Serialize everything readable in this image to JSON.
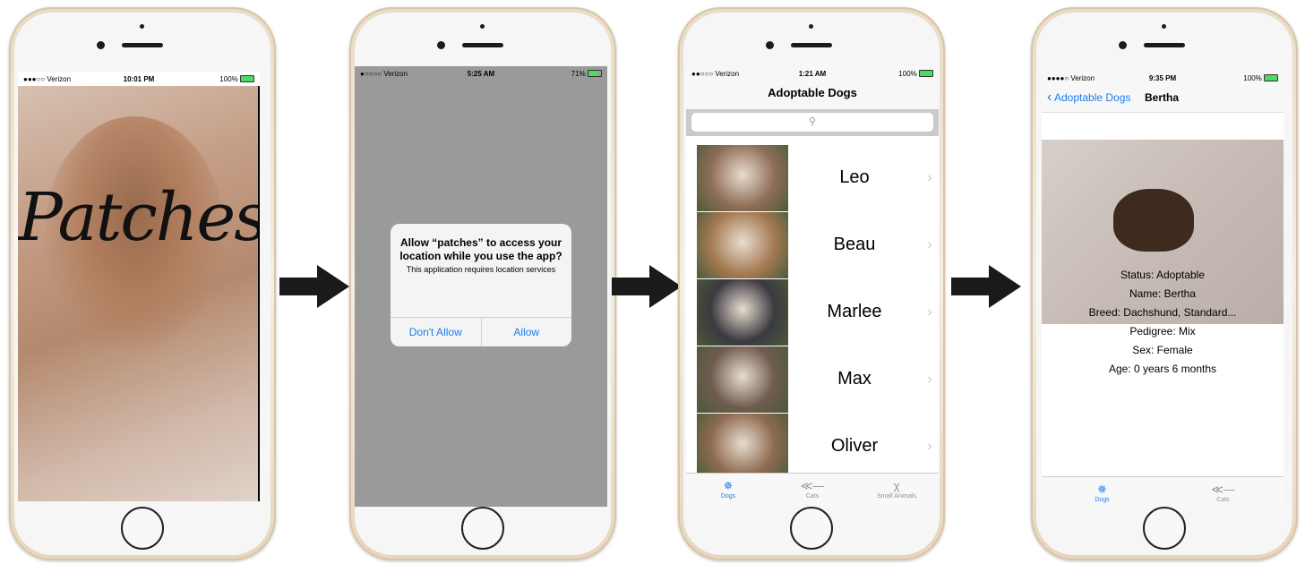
{
  "screen1": {
    "status": {
      "carrier": "●●●○○ Verizon",
      "time": "10:01 PM",
      "battery": "100%"
    },
    "title": "Patches"
  },
  "screen2": {
    "status": {
      "carrier": "●○○○○ Verizon",
      "time": "5:25 AM",
      "battery": "71%"
    },
    "alert": {
      "title": "Allow “patches” to access your location while you use the app?",
      "message": "This application requires location services",
      "deny": "Don't Allow",
      "allow": "Allow"
    }
  },
  "screen3": {
    "status": {
      "carrier": "●●○○○ Verizon",
      "time": "1:21 AM",
      "battery": "100%"
    },
    "title": "Adoptable Dogs",
    "dogs": [
      {
        "name": "Leo"
      },
      {
        "name": "Beau"
      },
      {
        "name": "Marlee"
      },
      {
        "name": "Max"
      },
      {
        "name": "Oliver"
      }
    ],
    "tabs": [
      {
        "label": "Dogs",
        "icon": "bone-icon"
      },
      {
        "label": "Cats",
        "icon": "fish-icon"
      },
      {
        "label": "Small Animals",
        "icon": "rabbit-icon"
      }
    ]
  },
  "screen4": {
    "status": {
      "carrier": "●●●●○ Verizon",
      "time": "9:35 PM",
      "battery": "100%"
    },
    "back": "Adoptable Dogs",
    "title": "Bertha",
    "info": [
      "Status: Adoptable",
      "Name: Bertha",
      "Breed: Dachshund, Standard...",
      "Pedigree: Mix",
      "Sex: Female",
      "Age: 0 years 6 months"
    ],
    "tabs": [
      {
        "label": "Dogs",
        "icon": "bone-icon"
      },
      {
        "label": "Cats",
        "icon": "fish-icon"
      }
    ]
  },
  "colors": {
    "tint": "#1a7ef0",
    "battery_green": "#4cd964",
    "alert_backdrop": "#9a9a9a"
  }
}
